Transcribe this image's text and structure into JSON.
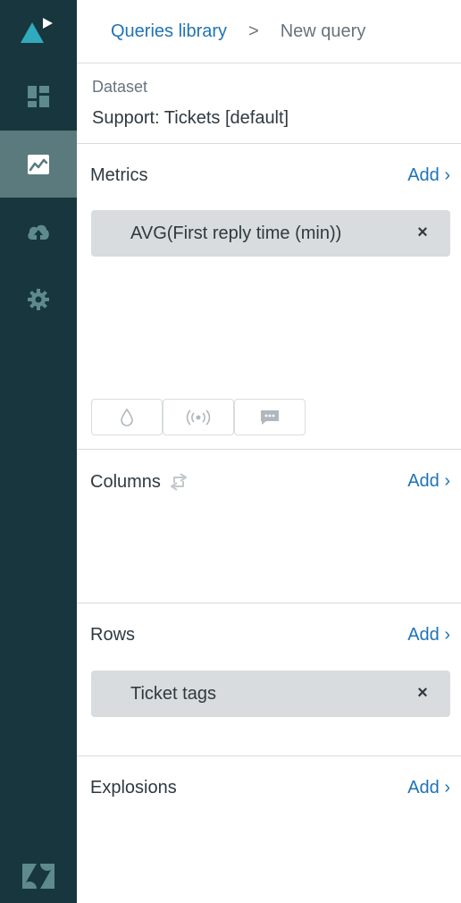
{
  "nav": {
    "items": [
      {
        "icon": "dashboard-icon",
        "active": false
      },
      {
        "icon": "chart-icon",
        "active": true
      },
      {
        "icon": "cloud-upload-icon",
        "active": false
      },
      {
        "icon": "gear-icon",
        "active": false
      }
    ]
  },
  "breadcrumb": {
    "parent": "Queries library",
    "separator": ">",
    "current": "New query"
  },
  "dataset": {
    "label": "Dataset",
    "value": "Support: Tickets [default]"
  },
  "metrics": {
    "title": "Metrics",
    "add_label": "Add ›",
    "items": [
      "AVG(First reply time (min))"
    ]
  },
  "columns": {
    "title": "Columns",
    "add_label": "Add ›"
  },
  "rows": {
    "title": "Rows",
    "add_label": "Add ›",
    "items": [
      "Ticket tags"
    ]
  },
  "explosions": {
    "title": "Explosions",
    "add_label": "Add ›"
  },
  "colors": {
    "rail_bg": "#17363d",
    "rail_active": "#5a7a7d",
    "accent": "#1f73b7",
    "pill_bg": "#d8dcde"
  }
}
